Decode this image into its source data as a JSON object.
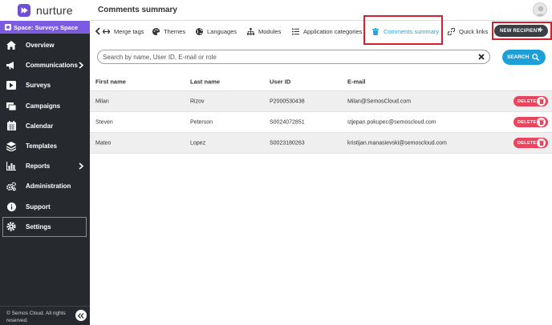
{
  "brand": {
    "name": "nurture"
  },
  "sidebar": {
    "space_label": "Space: Surveys Space",
    "items": [
      {
        "label": "Overview",
        "icon": "home-icon",
        "has_submenu": false
      },
      {
        "label": "Communications",
        "icon": "megaphone-icon",
        "has_submenu": true
      },
      {
        "label": "Surveys",
        "icon": "surveys-icon",
        "has_submenu": false
      },
      {
        "label": "Campaigns",
        "icon": "campaigns-icon",
        "has_submenu": false
      },
      {
        "label": "Calendar",
        "icon": "calendar-icon",
        "has_submenu": false
      },
      {
        "label": "Templates",
        "icon": "layers-icon",
        "has_submenu": false
      },
      {
        "label": "Reports",
        "icon": "chart-icon",
        "has_submenu": true
      },
      {
        "label": "Administration",
        "icon": "cogs-icon",
        "has_submenu": false
      },
      {
        "label": "Support",
        "icon": "info-icon",
        "has_submenu": false
      },
      {
        "label": "Settings",
        "icon": "gear-icon",
        "has_submenu": false
      }
    ],
    "footer_line1": "© Semos Cloud. All rights",
    "footer_line2": "reserved."
  },
  "header": {
    "title": "Comments summary"
  },
  "toolbar": {
    "items": [
      {
        "label": "Merge tags",
        "icon": "merge-icon"
      },
      {
        "label": "Themes",
        "icon": "palette-icon"
      },
      {
        "label": "Languages",
        "icon": "globe-icon"
      },
      {
        "label": "Modules",
        "icon": "sitemap-icon"
      },
      {
        "label": "Application categories",
        "icon": "list-icon"
      },
      {
        "label": "Comments summary",
        "icon": "trash-icon",
        "active": true
      },
      {
        "label": "Quick links",
        "icon": "link-icon"
      }
    ],
    "new_button": "NEW RECIPIENT"
  },
  "search": {
    "placeholder": "Search by name, User ID, E-mail or role",
    "button": "SEARCH"
  },
  "table": {
    "columns": [
      "First name",
      "Last name",
      "User ID",
      "E-mail"
    ],
    "rows": [
      {
        "first": "Milan",
        "last": "Rizov",
        "id": "P2000530438",
        "email": "Milan@SemosCloud.com"
      },
      {
        "first": "Steven",
        "last": "Peterson",
        "id": "S0024072851",
        "email": "stjepan.pokupec@semoscloud.com"
      },
      {
        "first": "Mateo",
        "last": "Lopez",
        "id": "S0023180263",
        "email": "kristijan.manasievski@semoscloud.com"
      }
    ],
    "delete_label": "DELETE"
  },
  "colors": {
    "sidebar_bg": "#262a2f",
    "brand_purple": "#7b5ce1",
    "accent_blue": "#1e9fd8",
    "delete_red": "#e8455e",
    "highlight_red": "#d61f2c"
  }
}
